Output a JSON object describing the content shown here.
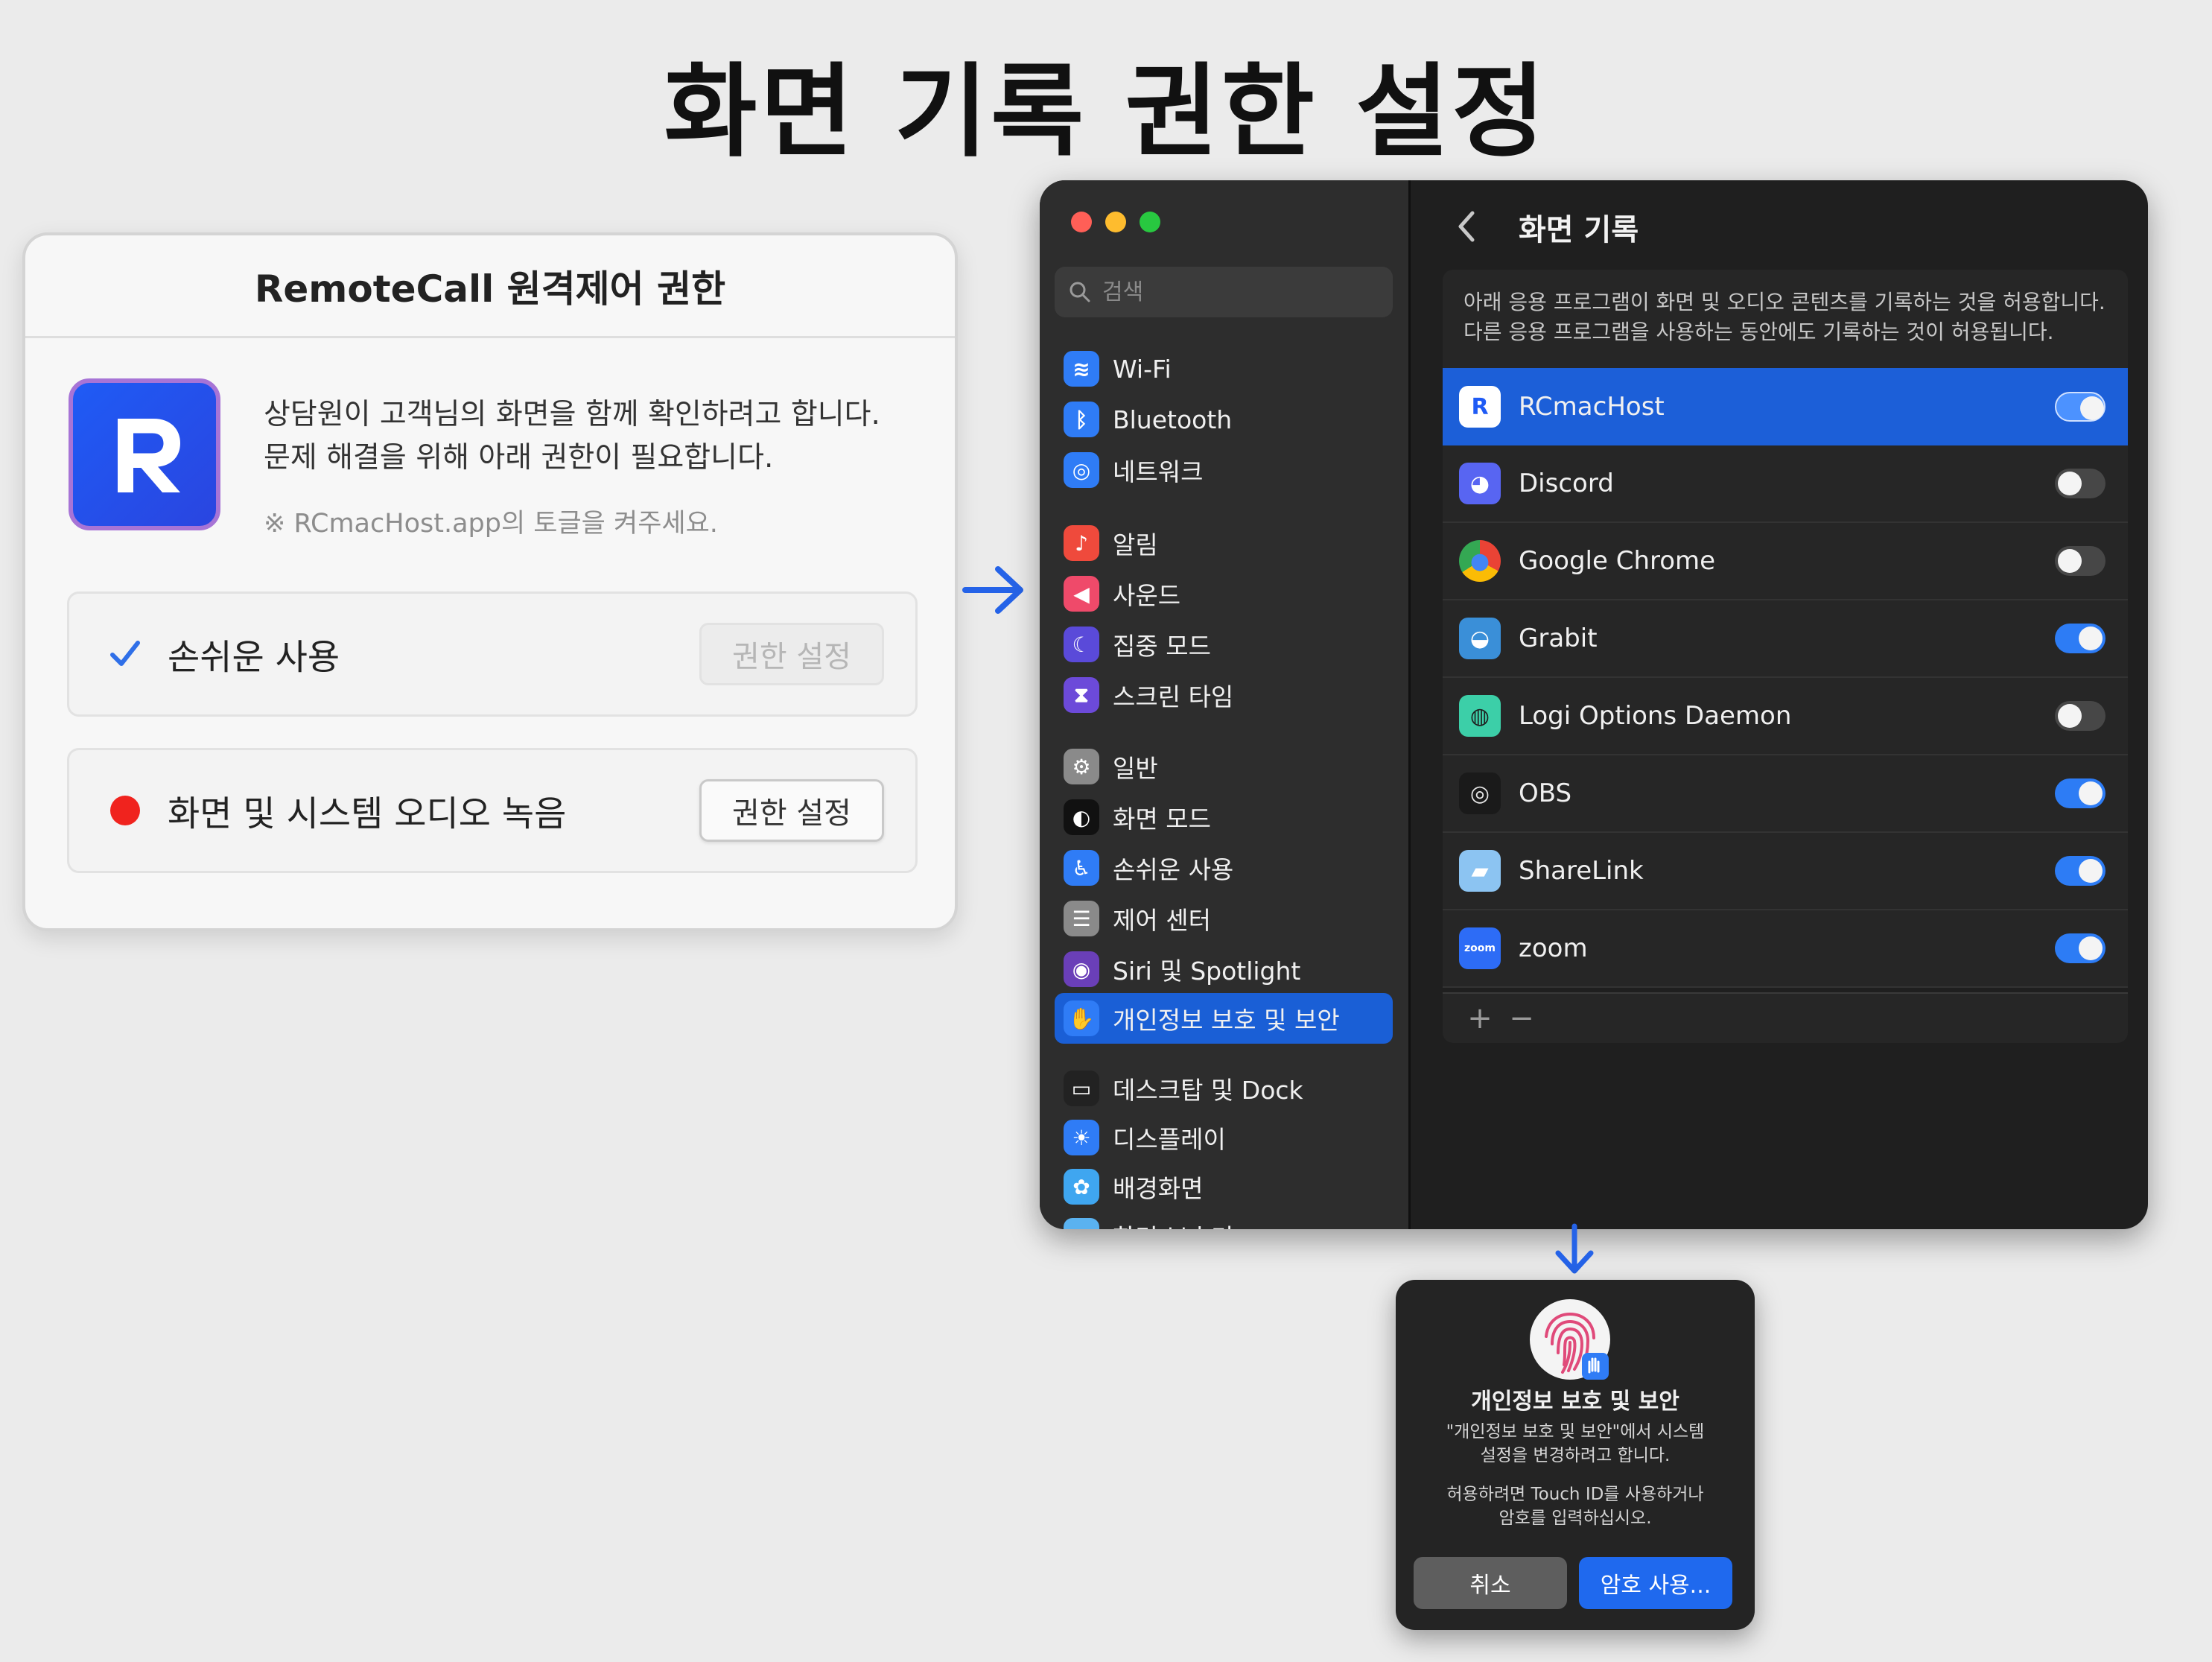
{
  "page": {
    "title": "화면 기록 권한 설정"
  },
  "remotecall_dialog": {
    "title": "RemoteCall 원격제어 권한",
    "description_line1": "상담원이 고객님의 화면을 함께 확인하려고 합니다.",
    "description_line2": "문제 해결을 위해 아래 권한이 필요합니다.",
    "note": "※ RCmacHost.app의 토글을 켜주세요.",
    "permissions": [
      {
        "label": "손쉬운 사용",
        "status": "granted",
        "button": "권한 설정"
      },
      {
        "label": "화면 및 시스템 오디오 녹음",
        "status": "needed",
        "button": "권한 설정"
      }
    ]
  },
  "settings_window": {
    "search_placeholder": "검색",
    "sidebar": [
      {
        "label": "Wi-Fi",
        "icon": "wifi-icon",
        "color": "#2f7cf6"
      },
      {
        "label": "Bluetooth",
        "icon": "bluetooth-icon",
        "color": "#2f7cf6"
      },
      {
        "label": "네트워크",
        "icon": "globe-icon",
        "color": "#2f7cf6"
      },
      {
        "label": "알림",
        "icon": "bell-icon",
        "color": "#ef4a3c"
      },
      {
        "label": "사운드",
        "icon": "speaker-icon",
        "color": "#ef4a6a"
      },
      {
        "label": "집중 모드",
        "icon": "moon-icon",
        "color": "#5a4ad9"
      },
      {
        "label": "스크린 타임",
        "icon": "hourglass-icon",
        "color": "#6c4ad9"
      },
      {
        "label": "일반",
        "icon": "gear-icon",
        "color": "#8a8a8a"
      },
      {
        "label": "화면 모드",
        "icon": "appearance-icon",
        "color": "#111111"
      },
      {
        "label": "손쉬운 사용",
        "icon": "accessibility-icon",
        "color": "#2f7cf6"
      },
      {
        "label": "제어 센터",
        "icon": "control-center-icon",
        "color": "#8a8a8a"
      },
      {
        "label": "Siri 및 Spotlight",
        "icon": "siri-icon",
        "color": "#6a3fb8"
      },
      {
        "label": "개인정보 보호 및 보안",
        "icon": "hand-icon",
        "color": "#2f7cf6"
      },
      {
        "label": "데스크탑 및 Dock",
        "icon": "dock-icon",
        "color": "#222222"
      },
      {
        "label": "디스플레이",
        "icon": "sun-icon",
        "color": "#2f7cf6"
      },
      {
        "label": "배경화면",
        "icon": "wallpaper-icon",
        "color": "#3fa6f0"
      },
      {
        "label": "화면 보호기",
        "icon": "screensaver-icon",
        "color": "#5ab2f0"
      }
    ],
    "selected_item": "개인정보 보호 및 보안",
    "content": {
      "title": "화면 기록",
      "description_line1": "아래 응용 프로그램이 화면 및 오디오 콘텐츠를 기록하는 것을 허용합니다.",
      "description_line2": "다른 응용 프로그램을 사용하는 동안에도 기록하는 것이 허용됩니다.",
      "apps": [
        {
          "name": "RCmacHost",
          "enabled": true,
          "selected": true,
          "icon": "rcmachost-icon"
        },
        {
          "name": "Discord",
          "enabled": false,
          "icon": "discord-icon"
        },
        {
          "name": "Google Chrome",
          "enabled": false,
          "icon": "chrome-icon"
        },
        {
          "name": "Grabit",
          "enabled": true,
          "icon": "grabit-icon"
        },
        {
          "name": "Logi Options Daemon",
          "enabled": false,
          "icon": "logi-icon"
        },
        {
          "name": "OBS",
          "enabled": true,
          "icon": "obs-icon"
        },
        {
          "name": "ShareLink",
          "enabled": true,
          "icon": "sharelink-icon"
        },
        {
          "name": "zoom",
          "enabled": true,
          "icon": "zoom-icon"
        }
      ],
      "footer_add": "+",
      "footer_remove": "−"
    }
  },
  "auth_dialog": {
    "title": "개인정보 보호 및 보안",
    "message_line1": "\"개인정보 보호 및 보안\"에서 시스템",
    "message_line2": "설정을 변경하려고 합니다.",
    "hint_line1": "허용하려면 Touch ID를 사용하거나",
    "hint_line2": "암호를 입력하십시오.",
    "cancel": "취소",
    "confirm": "암호 사용..."
  },
  "colors": {
    "accent": "#1f69ee",
    "selection": "#1c5fd8",
    "toggle_on": "#2d7cf5",
    "needed": "#f0231e",
    "granted_check": "#2f6fe8"
  }
}
